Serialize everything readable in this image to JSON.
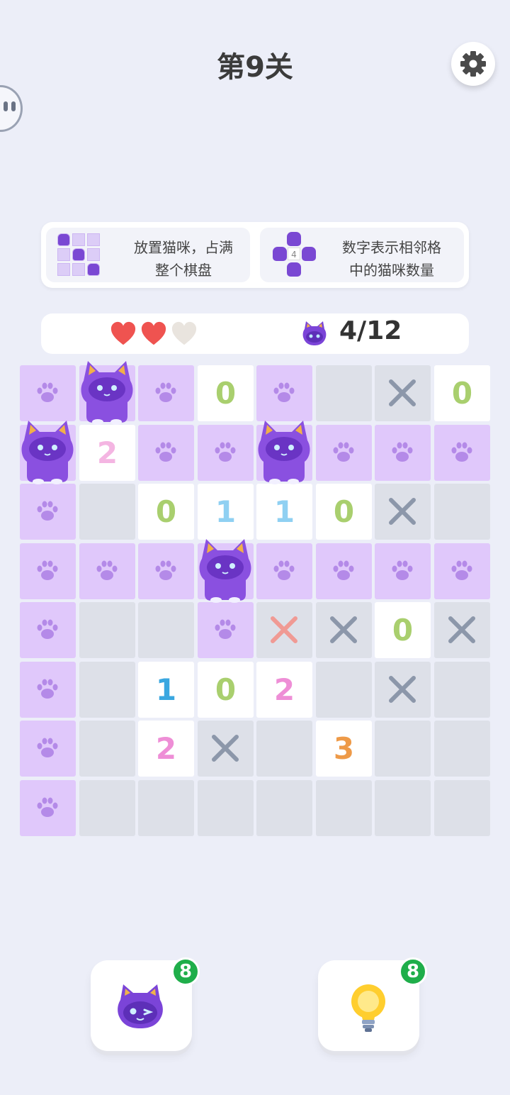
{
  "header": {
    "title": "第9关"
  },
  "tips": [
    {
      "line1": "放置猫咪，占满",
      "line2": "整个棋盘"
    },
    {
      "line1": "数字表示相邻格",
      "line2": "中的猫咪数量",
      "example_number": "4"
    }
  ],
  "status": {
    "hearts": [
      "full",
      "full",
      "empty"
    ],
    "cat_count": "4/12"
  },
  "board": {
    "rows": [
      [
        {
          "t": "paw"
        },
        {
          "t": "cat"
        },
        {
          "t": "paw"
        },
        {
          "t": "num",
          "v": "0"
        },
        {
          "t": "paw"
        },
        {
          "t": "empty"
        },
        {
          "t": "x"
        },
        {
          "t": "num",
          "v": "0"
        }
      ],
      [
        {
          "t": "cat"
        },
        {
          "t": "num",
          "v": "2"
        },
        {
          "t": "paw"
        },
        {
          "t": "paw"
        },
        {
          "t": "cat"
        },
        {
          "t": "paw"
        },
        {
          "t": "paw"
        },
        {
          "t": "paw"
        }
      ],
      [
        {
          "t": "paw"
        },
        {
          "t": "empty"
        },
        {
          "t": "num",
          "v": "0"
        },
        {
          "t": "num",
          "v": "1"
        },
        {
          "t": "num",
          "v": "1"
        },
        {
          "t": "num",
          "v": "0"
        },
        {
          "t": "x"
        },
        {
          "t": "empty"
        }
      ],
      [
        {
          "t": "paw"
        },
        {
          "t": "paw"
        },
        {
          "t": "paw"
        },
        {
          "t": "cat"
        },
        {
          "t": "paw"
        },
        {
          "t": "paw"
        },
        {
          "t": "paw"
        },
        {
          "t": "paw"
        }
      ],
      [
        {
          "t": "paw"
        },
        {
          "t": "empty"
        },
        {
          "t": "empty"
        },
        {
          "t": "paw"
        },
        {
          "t": "xr"
        },
        {
          "t": "x"
        },
        {
          "t": "num",
          "v": "0"
        },
        {
          "t": "x"
        }
      ],
      [
        {
          "t": "paw"
        },
        {
          "t": "empty"
        },
        {
          "t": "num",
          "v": "1"
        },
        {
          "t": "num",
          "v": "0"
        },
        {
          "t": "num",
          "v": "2"
        },
        {
          "t": "empty"
        },
        {
          "t": "x"
        },
        {
          "t": "empty"
        }
      ],
      [
        {
          "t": "paw"
        },
        {
          "t": "empty"
        },
        {
          "t": "num",
          "v": "2"
        },
        {
          "t": "x"
        },
        {
          "t": "empty"
        },
        {
          "t": "num",
          "v": "3"
        },
        {
          "t": "empty"
        },
        {
          "t": "empty"
        }
      ],
      [
        {
          "t": "paw"
        },
        {
          "t": "empty"
        },
        {
          "t": "empty"
        },
        {
          "t": "empty"
        },
        {
          "t": "empty"
        },
        {
          "t": "empty"
        },
        {
          "t": "empty"
        },
        {
          "t": "empty"
        }
      ]
    ],
    "number_colors": {
      "0": "#a9cf6e",
      "1": "#3aa7e0",
      "2": "#ee8ed6",
      "3": "#ee9a48"
    },
    "number_colors_light": {
      "1": "#8fd0f2",
      "2": "#f4b5e2"
    }
  },
  "powerups": [
    {
      "icon": "cat-icon",
      "count": "8"
    },
    {
      "icon": "lightbulb-icon",
      "count": "8"
    }
  ]
}
